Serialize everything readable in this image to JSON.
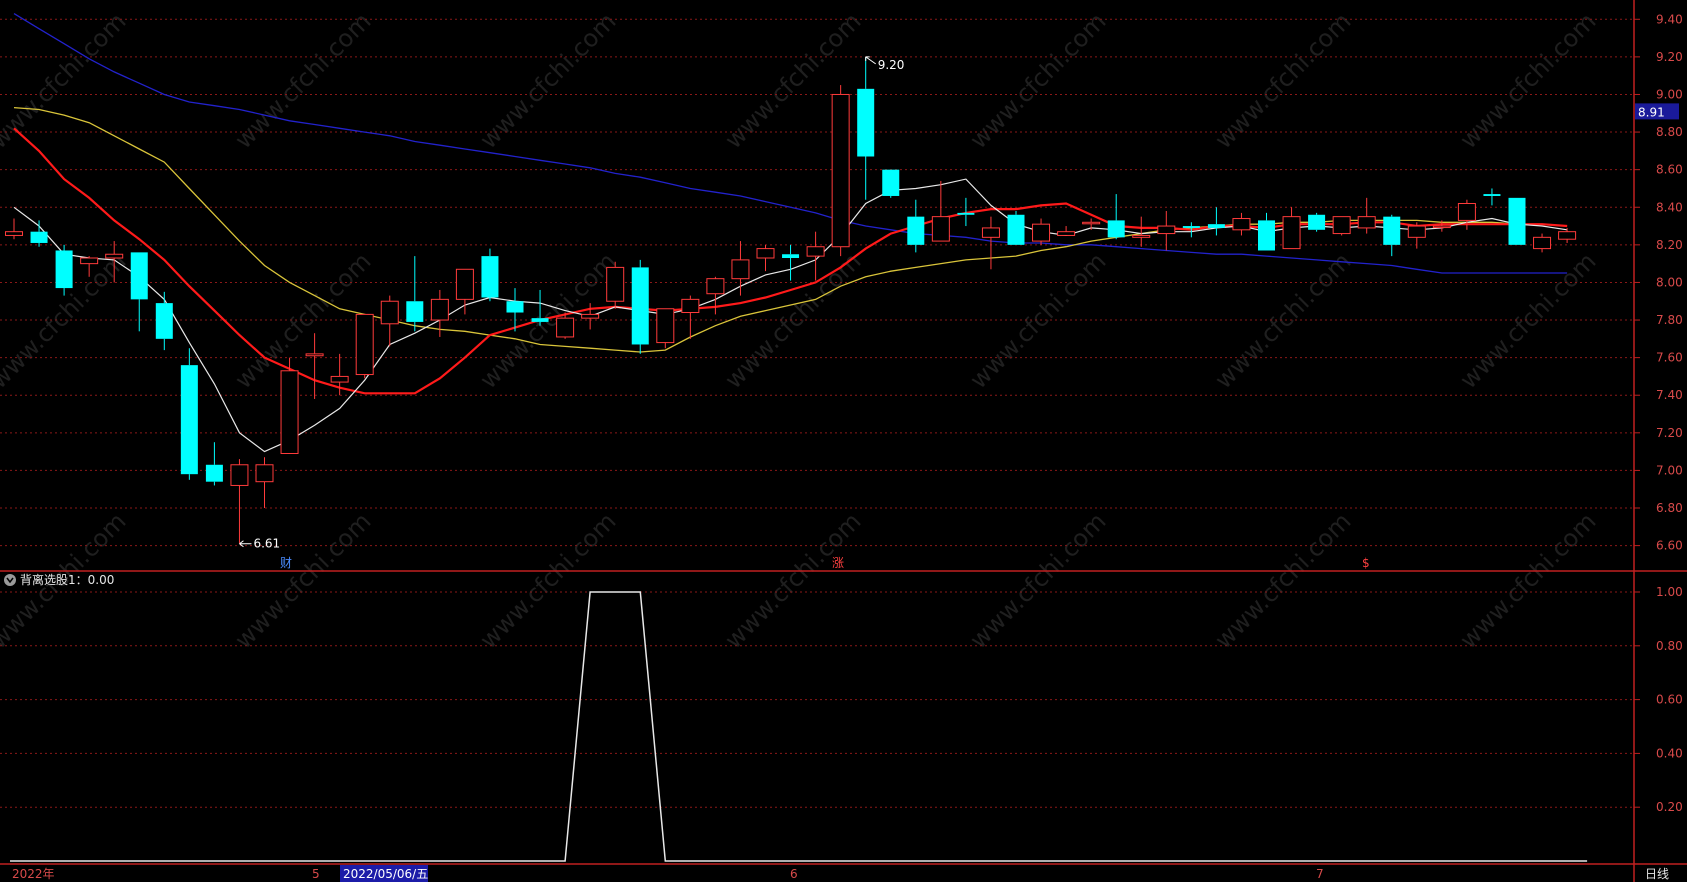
{
  "indicator_title": "背离选股1：0.00",
  "watermark": "www.cfchi.com",
  "period_label": "日线",
  "current_price": "8.91",
  "markers": {
    "high_label": "9.20",
    "low_label": "6.61",
    "event_labels": [
      "财",
      "涨",
      "$"
    ]
  },
  "date_axis": {
    "year_label": "2022年",
    "month_labels": [
      "5",
      "6",
      "7"
    ],
    "cursor_date": "2022/05/06/五"
  },
  "colors": {
    "background": "#000000",
    "up": "#ff3b3b",
    "down": "#00ffff",
    "ma_white": "#e8e8e8",
    "ma_red": "#ff1a1a",
    "ma_yellow": "#d9c43a",
    "ma_blue": "#2222cc",
    "axis": "#c02020",
    "grid": "#8a1818"
  },
  "chart_data": [
    {
      "type": "candlestick",
      "y_ticks": [
        "9.40",
        "9.20",
        "9.00",
        "8.80",
        "8.60",
        "8.40",
        "8.20",
        "8.00",
        "7.80",
        "7.60",
        "7.40",
        "7.20",
        "7.00",
        "6.80",
        "6.60"
      ],
      "ylim": [
        6.55,
        9.46
      ],
      "candles": [
        {
          "o": 8.25,
          "h": 8.34,
          "l": 8.23,
          "c": 8.27
        },
        {
          "o": 8.27,
          "h": 8.33,
          "l": 8.19,
          "c": 8.21
        },
        {
          "o": 8.17,
          "h": 8.2,
          "l": 7.93,
          "c": 7.97
        },
        {
          "o": 8.1,
          "h": 8.14,
          "l": 8.03,
          "c": 8.13
        },
        {
          "o": 8.13,
          "h": 8.22,
          "l": 8.0,
          "c": 8.15
        },
        {
          "o": 8.16,
          "h": 8.16,
          "l": 7.74,
          "c": 7.91
        },
        {
          "o": 7.89,
          "h": 7.95,
          "l": 7.64,
          "c": 7.7
        },
        {
          "o": 7.56,
          "h": 7.65,
          "l": 6.95,
          "c": 6.98
        },
        {
          "o": 7.03,
          "h": 7.15,
          "l": 6.92,
          "c": 6.94
        },
        {
          "o": 6.92,
          "h": 7.06,
          "l": 6.61,
          "c": 7.03
        },
        {
          "o": 6.94,
          "h": 7.07,
          "l": 6.8,
          "c": 7.03
        },
        {
          "o": 7.09,
          "h": 7.6,
          "l": 7.09,
          "c": 7.53
        },
        {
          "o": 7.61,
          "h": 7.73,
          "l": 7.38,
          "c": 7.62
        },
        {
          "o": 7.47,
          "h": 7.62,
          "l": 7.4,
          "c": 7.5
        },
        {
          "o": 7.51,
          "h": 7.82,
          "l": 7.49,
          "c": 7.83
        },
        {
          "o": 7.78,
          "h": 7.93,
          "l": 7.66,
          "c": 7.9
        },
        {
          "o": 7.9,
          "h": 8.14,
          "l": 7.74,
          "c": 7.79
        },
        {
          "o": 7.8,
          "h": 7.96,
          "l": 7.71,
          "c": 7.91
        },
        {
          "o": 7.91,
          "h": 8.06,
          "l": 7.83,
          "c": 8.07
        },
        {
          "o": 8.14,
          "h": 8.18,
          "l": 7.9,
          "c": 7.92
        },
        {
          "o": 7.9,
          "h": 7.97,
          "l": 7.74,
          "c": 7.84
        },
        {
          "o": 7.81,
          "h": 7.96,
          "l": 7.77,
          "c": 7.79
        },
        {
          "o": 7.71,
          "h": 7.84,
          "l": 7.7,
          "c": 7.81
        },
        {
          "o": 7.81,
          "h": 7.89,
          "l": 7.75,
          "c": 7.83
        },
        {
          "o": 7.9,
          "h": 8.11,
          "l": 7.86,
          "c": 8.08
        },
        {
          "o": 8.08,
          "h": 8.12,
          "l": 7.62,
          "c": 7.67
        },
        {
          "o": 7.68,
          "h": 7.86,
          "l": 7.65,
          "c": 7.86
        },
        {
          "o": 7.84,
          "h": 7.93,
          "l": 7.7,
          "c": 7.91
        },
        {
          "o": 7.94,
          "h": 8.03,
          "l": 7.83,
          "c": 8.02
        },
        {
          "o": 8.02,
          "h": 8.22,
          "l": 7.93,
          "c": 8.12
        },
        {
          "o": 8.13,
          "h": 8.2,
          "l": 8.06,
          "c": 8.18
        },
        {
          "o": 8.15,
          "h": 8.2,
          "l": 8.01,
          "c": 8.13
        },
        {
          "o": 8.14,
          "h": 8.27,
          "l": 8.01,
          "c": 8.19
        },
        {
          "o": 8.19,
          "h": 9.05,
          "l": 8.14,
          "c": 9.0
        },
        {
          "o": 9.03,
          "h": 9.2,
          "l": 8.44,
          "c": 8.67
        },
        {
          "o": 8.6,
          "h": 8.6,
          "l": 8.45,
          "c": 8.46
        },
        {
          "o": 8.35,
          "h": 8.44,
          "l": 8.16,
          "c": 8.2
        },
        {
          "o": 8.22,
          "h": 8.54,
          "l": 8.22,
          "c": 8.35
        },
        {
          "o": 8.37,
          "h": 8.45,
          "l": 8.3,
          "c": 8.36
        },
        {
          "o": 8.24,
          "h": 8.35,
          "l": 8.07,
          "c": 8.29
        },
        {
          "o": 8.36,
          "h": 8.38,
          "l": 8.2,
          "c": 8.2
        },
        {
          "o": 8.22,
          "h": 8.34,
          "l": 8.2,
          "c": 8.31
        },
        {
          "o": 8.25,
          "h": 8.3,
          "l": 8.25,
          "c": 8.27
        },
        {
          "o": 8.32,
          "h": 8.34,
          "l": 8.28,
          "c": 8.32
        },
        {
          "o": 8.33,
          "h": 8.47,
          "l": 8.23,
          "c": 8.24
        },
        {
          "o": 8.24,
          "h": 8.35,
          "l": 8.19,
          "c": 8.25
        },
        {
          "o": 8.26,
          "h": 8.38,
          "l": 8.17,
          "c": 8.3
        },
        {
          "o": 8.3,
          "h": 8.32,
          "l": 8.24,
          "c": 8.29
        },
        {
          "o": 8.31,
          "h": 8.4,
          "l": 8.25,
          "c": 8.29
        },
        {
          "o": 8.28,
          "h": 8.37,
          "l": 8.25,
          "c": 8.34
        },
        {
          "o": 8.33,
          "h": 8.37,
          "l": 8.17,
          "c": 8.17
        },
        {
          "o": 8.18,
          "h": 8.4,
          "l": 8.18,
          "c": 8.35
        },
        {
          "o": 8.36,
          "h": 8.37,
          "l": 8.27,
          "c": 8.28
        },
        {
          "o": 8.26,
          "h": 8.35,
          "l": 8.25,
          "c": 8.35
        },
        {
          "o": 8.29,
          "h": 8.45,
          "l": 8.26,
          "c": 8.35
        },
        {
          "o": 8.35,
          "h": 8.36,
          "l": 8.14,
          "c": 8.2
        },
        {
          "o": 8.24,
          "h": 8.32,
          "l": 8.18,
          "c": 8.3
        },
        {
          "o": 8.3,
          "h": 8.33,
          "l": 8.27,
          "c": 8.3
        },
        {
          "o": 8.33,
          "h": 8.44,
          "l": 8.28,
          "c": 8.42
        },
        {
          "o": 8.47,
          "h": 8.5,
          "l": 8.41,
          "c": 8.46
        },
        {
          "o": 8.45,
          "h": 8.45,
          "l": 8.2,
          "c": 8.2
        },
        {
          "o": 8.18,
          "h": 8.26,
          "l": 8.16,
          "c": 8.24
        },
        {
          "o": 8.23,
          "h": 8.29,
          "l": 8.21,
          "c": 8.27
        }
      ],
      "ma_lines": {
        "white": [
          8.4,
          8.3,
          8.15,
          8.13,
          8.12,
          8.03,
          7.91,
          7.68,
          7.46,
          7.2,
          7.1,
          7.16,
          7.24,
          7.33,
          7.48,
          7.67,
          7.73,
          7.8,
          7.88,
          7.92,
          7.9,
          7.89,
          7.85,
          7.82,
          7.87,
          7.85,
          7.83,
          7.86,
          7.91,
          7.98,
          8.04,
          8.07,
          8.12,
          8.25,
          8.42,
          8.49,
          8.5,
          8.52,
          8.55,
          8.41,
          8.31,
          8.27,
          8.25,
          8.29,
          8.28,
          8.26,
          8.27,
          8.27,
          8.29,
          8.3,
          8.27,
          8.29,
          8.3,
          8.29,
          8.3,
          8.29,
          8.28,
          8.29,
          8.32,
          8.34,
          8.31,
          8.3,
          8.28
        ],
        "red": [
          8.82,
          8.7,
          8.55,
          8.45,
          8.33,
          8.23,
          8.12,
          7.98,
          7.85,
          7.72,
          7.6,
          7.54,
          7.48,
          7.44,
          7.41,
          7.41,
          7.41,
          7.49,
          7.6,
          7.72,
          7.76,
          7.8,
          7.83,
          7.86,
          7.87,
          7.86,
          7.85,
          7.86,
          7.87,
          7.89,
          7.92,
          7.96,
          8.0,
          8.08,
          8.18,
          8.26,
          8.3,
          8.34,
          8.37,
          8.39,
          8.39,
          8.41,
          8.42,
          8.36,
          8.3,
          8.29,
          8.29,
          8.28,
          8.3,
          8.3,
          8.29,
          8.31,
          8.31,
          8.31,
          8.32,
          8.32,
          8.3,
          8.31,
          8.31,
          8.31,
          8.31,
          8.31,
          8.3
        ],
        "yellow": [
          8.93,
          8.92,
          8.89,
          8.85,
          8.78,
          8.71,
          8.64,
          8.5,
          8.36,
          8.22,
          8.09,
          8.0,
          7.93,
          7.86,
          7.83,
          7.8,
          7.77,
          7.75,
          7.74,
          7.72,
          7.7,
          7.67,
          7.66,
          7.65,
          7.64,
          7.63,
          7.64,
          7.71,
          7.77,
          7.82,
          7.85,
          7.88,
          7.91,
          7.98,
          8.03,
          8.06,
          8.08,
          8.1,
          8.12,
          8.13,
          8.14,
          8.17,
          8.19,
          8.22,
          8.24,
          8.26,
          8.28,
          8.29,
          8.3,
          8.31,
          8.31,
          8.32,
          8.32,
          8.33,
          8.33,
          8.33,
          8.33,
          8.32,
          8.32,
          8.32,
          8.31,
          8.31,
          8.3
        ],
        "blue": [
          9.43,
          9.35,
          9.27,
          9.19,
          9.12,
          9.06,
          9.0,
          8.96,
          8.94,
          8.92,
          8.89,
          8.86,
          8.84,
          8.82,
          8.8,
          8.78,
          8.75,
          8.73,
          8.71,
          8.69,
          8.67,
          8.65,
          8.63,
          8.61,
          8.58,
          8.56,
          8.53,
          8.5,
          8.48,
          8.46,
          8.43,
          8.4,
          8.37,
          8.33,
          8.3,
          8.28,
          8.26,
          8.25,
          8.24,
          8.22,
          8.21,
          8.21,
          8.2,
          8.2,
          8.19,
          8.18,
          8.17,
          8.16,
          8.15,
          8.15,
          8.14,
          8.13,
          8.12,
          8.11,
          8.1,
          8.09,
          8.07,
          8.05,
          8.05,
          8.05,
          8.05,
          8.05,
          8.05
        ]
      }
    },
    {
      "type": "line",
      "title": "背离选股1：0.00",
      "y_ticks": [
        "1.00",
        "0.80",
        "0.60",
        "0.40",
        "0.20"
      ],
      "ylim": [
        0,
        1
      ],
      "values": [
        0,
        0,
        0,
        0,
        0,
        0,
        0,
        0,
        0,
        0,
        0,
        0,
        0,
        0,
        0,
        0,
        0,
        0,
        0,
        0,
        0,
        0,
        0,
        1,
        1,
        1,
        0,
        0,
        0,
        0,
        0,
        0,
        0,
        0,
        0,
        0,
        0,
        0,
        0,
        0,
        0,
        0,
        0,
        0,
        0,
        0,
        0,
        0,
        0,
        0,
        0,
        0,
        0,
        0,
        0,
        0,
        0,
        0,
        0,
        0,
        0,
        0,
        0
      ]
    }
  ]
}
